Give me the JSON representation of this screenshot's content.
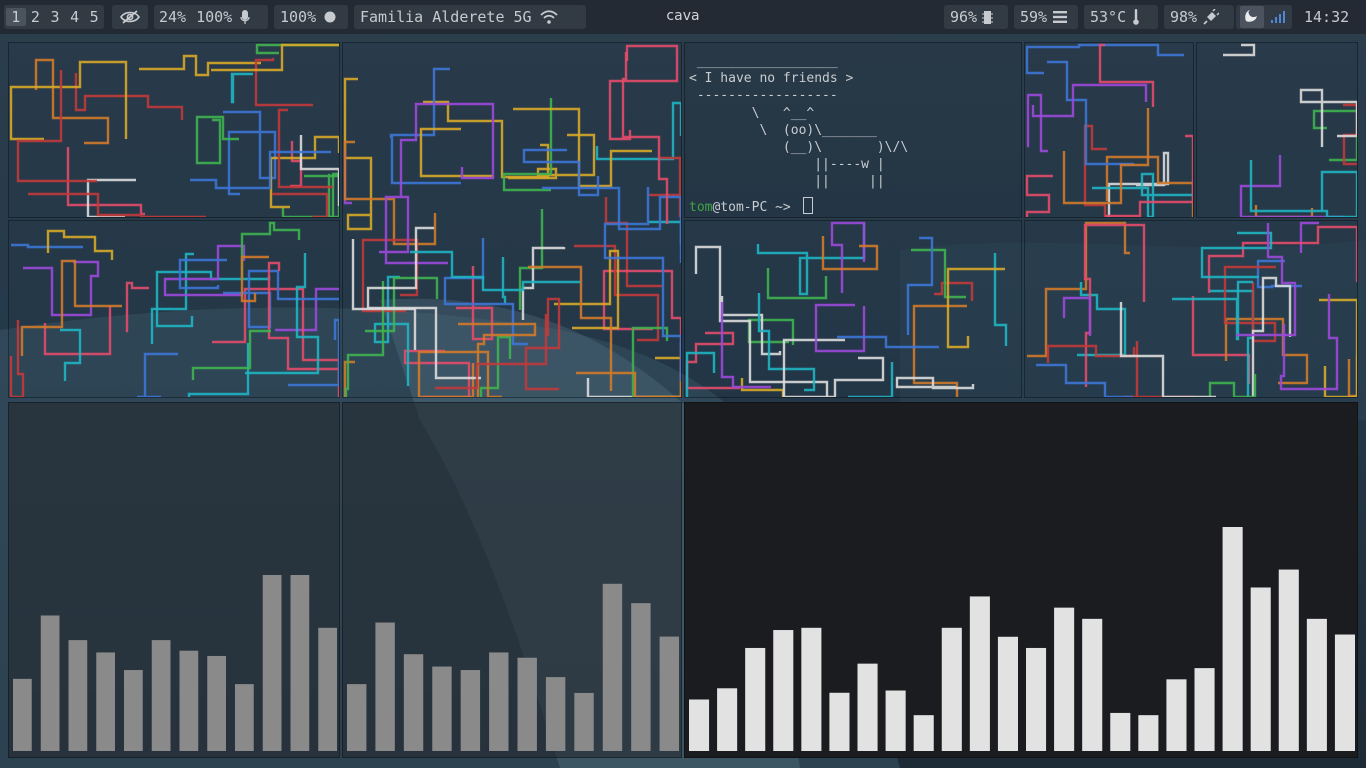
{
  "bar": {
    "workspaces": [
      "1",
      "2",
      "3",
      "4",
      "5"
    ],
    "active_workspace": "1",
    "idle_inhibitor_icon": "eye-slash-icon",
    "volume_out": "24%",
    "volume_in": "100%",
    "mic_icon": "microphone-icon",
    "brightness": "100%",
    "brightness_icon": "circle-icon",
    "network": "Familia Alderete 5G",
    "wifi_icon": "wifi-icon",
    "window_title": "cava",
    "cpu": "96%",
    "cpu_icon": "chip-icon",
    "memory": "59%",
    "memory_icon": "memory-icon",
    "temperature": "53°C",
    "temperature_icon": "thermometer-icon",
    "battery": "98%",
    "battery_icon": "plug-icon",
    "tray_icons": [
      "night-light-icon",
      "signal-bars-icon"
    ],
    "clock": "14:32"
  },
  "terminal": {
    "cowsay_lines": [
      " __________________",
      "< I have no friends >",
      " ------------------",
      "        \\   ^__^",
      "         \\  (oo)\\_______",
      "            (__)\\       )\\/\\",
      "                ||----w |",
      "                ||     ||"
    ],
    "prompt_user": "tom",
    "prompt_host": "@tom-PC",
    "prompt_symbol": " ~> "
  },
  "cava_panes": [
    {
      "name": "cava-left",
      "levels": [
        0.41,
        0.77,
        0.63,
        0.56,
        0.46,
        0.63,
        0.57,
        0.54,
        0.38,
        1.0,
        1.0,
        0.7
      ]
    },
    {
      "name": "cava-middle",
      "levels": [
        0.38,
        0.73,
        0.55,
        0.48,
        0.46,
        0.56,
        0.53,
        0.42,
        0.33,
        0.95,
        0.84,
        0.65
      ]
    },
    {
      "name": "cava-right",
      "levels": [
        0.23,
        0.28,
        0.46,
        0.54,
        0.55,
        0.26,
        0.39,
        0.27,
        0.16,
        0.55,
        0.69,
        0.51,
        0.46,
        0.64,
        0.59,
        0.17,
        0.16,
        0.32,
        0.37,
        1.0,
        0.73,
        0.81,
        0.59,
        0.52
      ]
    }
  ],
  "colors": {
    "bar_bg": "#232a33",
    "module_bg": "#323a44",
    "cava_left": "#8a8a8a",
    "cava_big": "#e2e2e2",
    "prompt_user": "#3fa344",
    "pipe_palette": [
      "#e34b6a",
      "#3fb34f",
      "#d7a928",
      "#3d76d6",
      "#9b49d9",
      "#1fb4c2",
      "#dcdcdc",
      "#c23a3a",
      "#d07a2a"
    ]
  }
}
